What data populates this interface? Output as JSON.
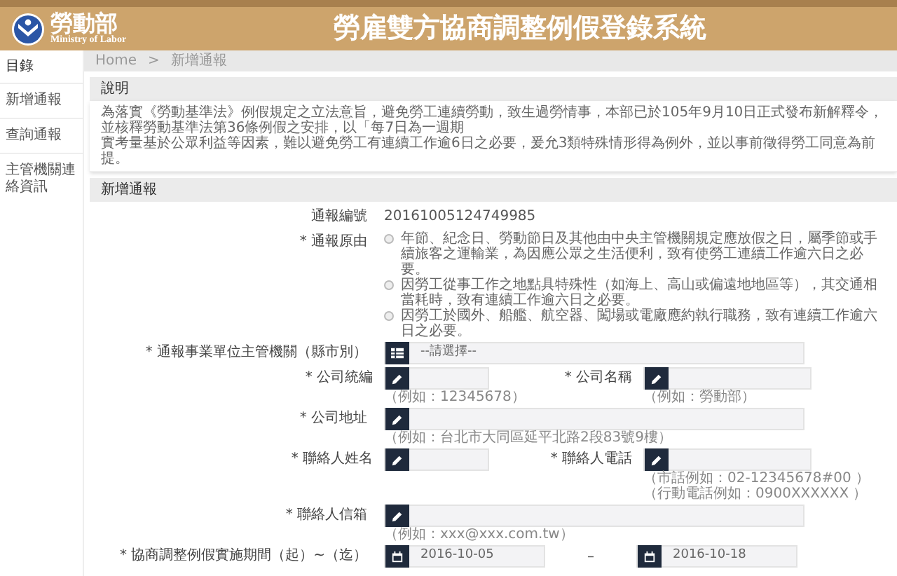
{
  "header": {
    "logo_title": "勞動部",
    "logo_subtitle": "Ministry of Labor",
    "title": "勞雇雙方協商調整例假登錄系統"
  },
  "sidebar": {
    "heading": "目錄",
    "items": [
      "新增通報",
      "查詢通報",
      "主管機關連絡資訊"
    ]
  },
  "breadcrumb": {
    "items": [
      "Home",
      "新增通報"
    ],
    "separator": ">"
  },
  "notice": {
    "title": "說明",
    "lines": [
      "為落實《勞動基準法》例假規定之立法意旨，避免勞工連續勞動，致生過勞情事，本部已於105年9月10日正式發布新解釋令，並核釋勞動基準法第36條例假之安排，以「每7日為一週期",
      "實考量基於公眾利益等因素，難以避免勞工有連續工作逾6日之必要，爰允3類特殊情形得為例外，並以事前徵得勞工同意為前提。"
    ]
  },
  "form": {
    "title": "新增通報",
    "rows": [
      {
        "kind": "text",
        "label": "通報編號",
        "value": "20161005124749985"
      },
      {
        "kind": "radio",
        "label": "* 通報原由",
        "options": [
          {
            "text": "年節、紀念日、勞動節日及其他由中央主管機關規定應放假之日，屬季節或手續旅客之運輸業，為因應公眾之生活便利，致有使勞工連續工作逾六日之必要。",
            "selected": false
          },
          {
            "text": "因勞工從事工作之地點具特殊性（如海上、高山或偏遠地地區等），其交通相當耗時，致有連續工作逾六日之必要。",
            "selected": false
          },
          {
            "text": "因勞工於國外、船艦、航空器、闖場或電廠應約執行職務，致有連續工作逾六日之必要。",
            "selected": false
          }
        ]
      },
      {
        "kind": "select",
        "label": "* 通報事業單位主管機關（縣市別）",
        "placeholder": "--請選擇--"
      },
      {
        "kind": "pair",
        "fields": [
          {
            "label": "* 公司統編",
            "hints": [
              "（例如：12345678）"
            ]
          },
          {
            "label": "* 公司名稱",
            "hints": [
              "（例如：勞動部）"
            ]
          }
        ]
      },
      {
        "kind": "input",
        "label": "* 公司地址",
        "hints": [
          "（例如：台北市大同區延平北路2段83號9樓）"
        ]
      },
      {
        "kind": "pair",
        "fields": [
          {
            "label": "* 聯絡人姓名"
          },
          {
            "label": "* 聯絡人電話",
            "hints": [
              "（市話例如：02-12345678#00 ）",
              "（行動電話例如：0900XXXXXX ）"
            ]
          }
        ]
      },
      {
        "kind": "input",
        "label": "* 聯絡人信箱",
        "hints": [
          "（例如：xxx@xxx.com.tw）"
        ]
      },
      {
        "kind": "daterange",
        "label": "* 協商調整例假實施期間（起）~（迄）",
        "from": "2016-10-05",
        "separator": "–",
        "to": "2016-10-18"
      }
    ]
  }
}
